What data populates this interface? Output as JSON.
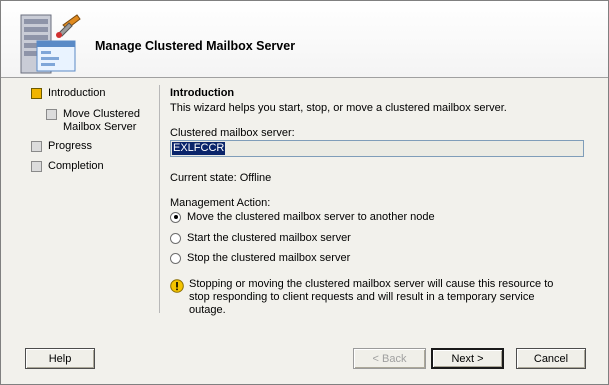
{
  "header": {
    "title": "Manage Clustered Mailbox Server",
    "icon": "exchange-management-wizard-icon"
  },
  "nav": {
    "items": [
      {
        "label": "Introduction",
        "state": "active"
      },
      {
        "label": "Move Clustered Mailbox Server",
        "state": "pending",
        "sub": true
      },
      {
        "label": "Progress",
        "state": "pending"
      },
      {
        "label": "Completion",
        "state": "pending"
      }
    ]
  },
  "content": {
    "title": "Introduction",
    "description": "This wizard helps you start, stop, or move a clustered mailbox server.",
    "server_label": "Clustered mailbox server:",
    "server_value": "EXLFCCR",
    "current_state": "Current state: Offline",
    "action_label": "Management Action:",
    "options": [
      {
        "label": "Move the clustered mailbox server to another node",
        "checked": true
      },
      {
        "label": "Start the clustered mailbox server",
        "checked": false
      },
      {
        "label": "Stop the clustered mailbox server",
        "checked": false
      }
    ],
    "warning": "Stopping or moving the clustered mailbox server will cause this resource to stop responding to client requests and will result in a temporary service outage."
  },
  "buttons": {
    "help": "Help",
    "back": "< Back",
    "next": "Next >",
    "cancel": "Cancel"
  },
  "colors": {
    "active_step": "#f0b400",
    "selection": "#0a246a",
    "warning": "#f5c400"
  }
}
